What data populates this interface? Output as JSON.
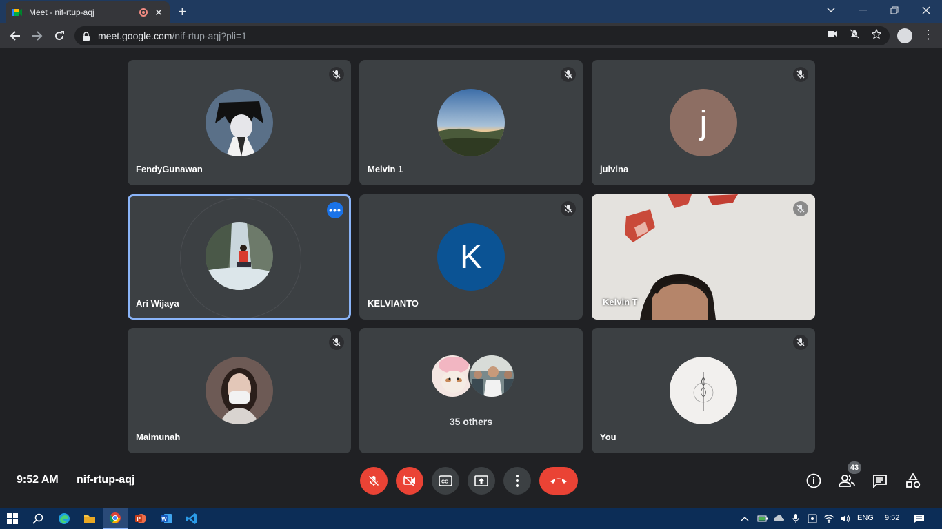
{
  "browser": {
    "tab_title": "Meet - nif-rtup-aqj",
    "url_host": "meet.google.com",
    "url_path": "/nif-rtup-aqj?pli=1"
  },
  "tiles": [
    {
      "name": "FendyGunawan",
      "avatar": "anime-photo"
    },
    {
      "name": "Melvin 1",
      "avatar": "landscape-photo"
    },
    {
      "name": "julvina",
      "avatar_letter": "j",
      "avatar_color": "#8d6e63"
    },
    {
      "name": "Ari Wijaya",
      "avatar": "waterfall-photo"
    },
    {
      "name": "KELVIANTO",
      "avatar_letter": "K",
      "avatar_color": "#0b5394"
    },
    {
      "name": "Kelvin T",
      "avatar": "video-feed"
    },
    {
      "name": "Maimunah",
      "avatar": "person-photo"
    },
    {
      "name": "35 others",
      "avatar": "group-photos"
    },
    {
      "name": "You",
      "avatar": "sketch-photo"
    }
  ],
  "bottom": {
    "time": "9:52 AM",
    "meeting_code": "nif-rtup-aqj",
    "participants_count": "43"
  },
  "taskbar": {
    "lang": "ENG",
    "time": "9:52"
  },
  "colors": {
    "accent": "#8ab4f8",
    "danger": "#ea4335",
    "tile_bg": "#3c4043",
    "page_bg": "#202124"
  }
}
